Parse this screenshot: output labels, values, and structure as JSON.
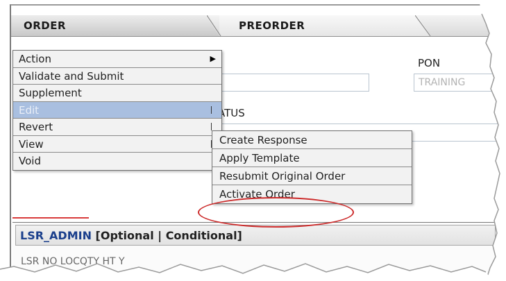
{
  "tabs": [
    {
      "label": "ORDER",
      "active": true
    },
    {
      "label": "PREORDER",
      "active": false
    }
  ],
  "form": {
    "label_t": "T",
    "label_pon": "PON",
    "pon_value": "TRAINING",
    "label_status": "TATUS"
  },
  "menu": {
    "items": [
      {
        "label": "Action",
        "has_submenu_arrow": true
      },
      {
        "label": "Validate and Submit"
      },
      {
        "label": "Supplement"
      },
      {
        "label": "Edit",
        "highlighted": true
      },
      {
        "label": "Revert"
      },
      {
        "label": "View"
      },
      {
        "label": "Void"
      }
    ]
  },
  "submenu": {
    "items": [
      {
        "label": "Create Response"
      },
      {
        "label": "Apply Template"
      },
      {
        "label": "Resubmit Original Order"
      },
      {
        "label": "Activate Order",
        "circled": true
      }
    ]
  },
  "panel": {
    "title_blue": "LSR_ADMIN",
    "title_rest": " [Optional | Conditional]",
    "fields": "LSR NO          LOCQTY    HT    Y"
  },
  "colors": {
    "highlight": "#a9bfe0",
    "circle": "#cc2a2a",
    "title_blue": "#1a3f8c"
  }
}
